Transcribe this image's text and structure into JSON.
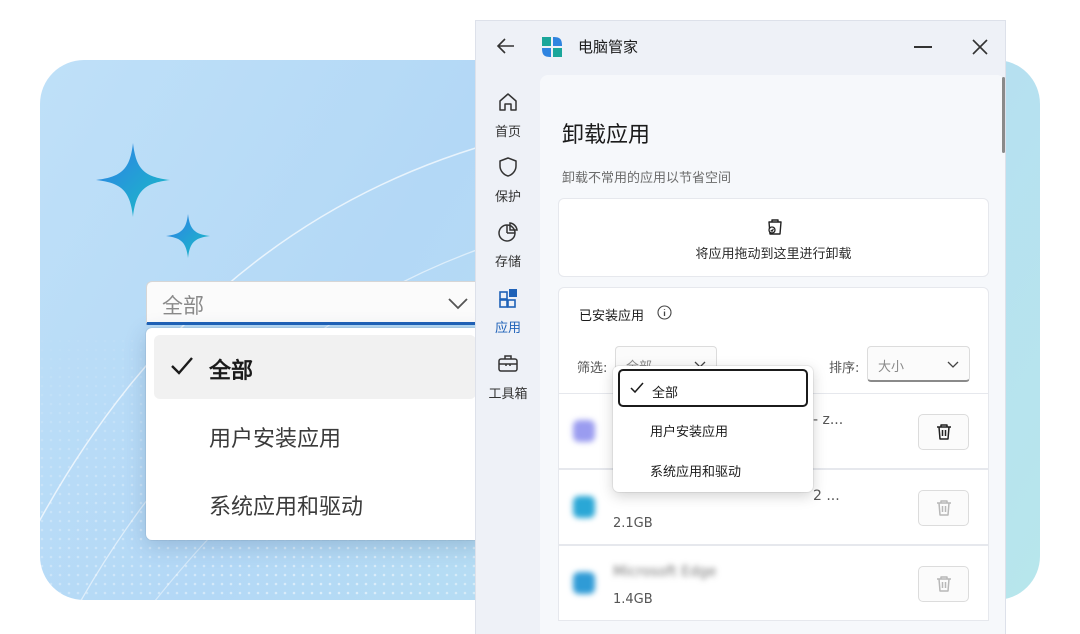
{
  "colors": {
    "accent": "#1f62b8",
    "background_card": "#b9dcf6"
  },
  "zoom_dropdown": {
    "value": "全部",
    "options": [
      {
        "label": "全部",
        "selected": true
      },
      {
        "label": "用户安装应用",
        "selected": false
      },
      {
        "label": "系统应用和驱动",
        "selected": false
      }
    ]
  },
  "window": {
    "title": "电脑管家",
    "controls": {
      "back_icon": "arrow-left-icon",
      "minimize_icon": "minimize-icon",
      "close_icon": "close-icon"
    }
  },
  "nav": [
    {
      "label": "首页",
      "icon": "home-icon",
      "active": false
    },
    {
      "label": "保护",
      "icon": "shield-icon",
      "active": false
    },
    {
      "label": "存储",
      "icon": "pie-chart-icon",
      "active": false
    },
    {
      "label": "应用",
      "icon": "apps-icon",
      "active": true
    },
    {
      "label": "工具箱",
      "icon": "toolbox-icon",
      "active": false
    }
  ],
  "page": {
    "title": "卸载应用",
    "subtitle": "卸载不常用的应用以节省空间",
    "drop_zone_text": "将应用拖动到这里进行卸载"
  },
  "installed": {
    "title": "已安装应用",
    "filter_label": "筛选:",
    "filter_value": "全部",
    "sort_label": "排序:",
    "sort_value": "大小",
    "filter_options": [
      {
        "label": "全部",
        "selected": true
      },
      {
        "label": "用户安装应用",
        "selected": false
      },
      {
        "label": "系统应用和驱动",
        "selected": false
      }
    ],
    "apps": [
      {
        "name": "- z...",
        "size": "",
        "icon_color": "#9a9cf0",
        "delete_enabled": true
      },
      {
        "name": "2 ...",
        "size": "2.1GB",
        "icon_color": "#2aa7d6",
        "delete_enabled": false
      },
      {
        "name": "Microsoft Edge",
        "size": "1.4GB",
        "icon_color": "#2f9bd6",
        "delete_enabled": false
      }
    ]
  }
}
